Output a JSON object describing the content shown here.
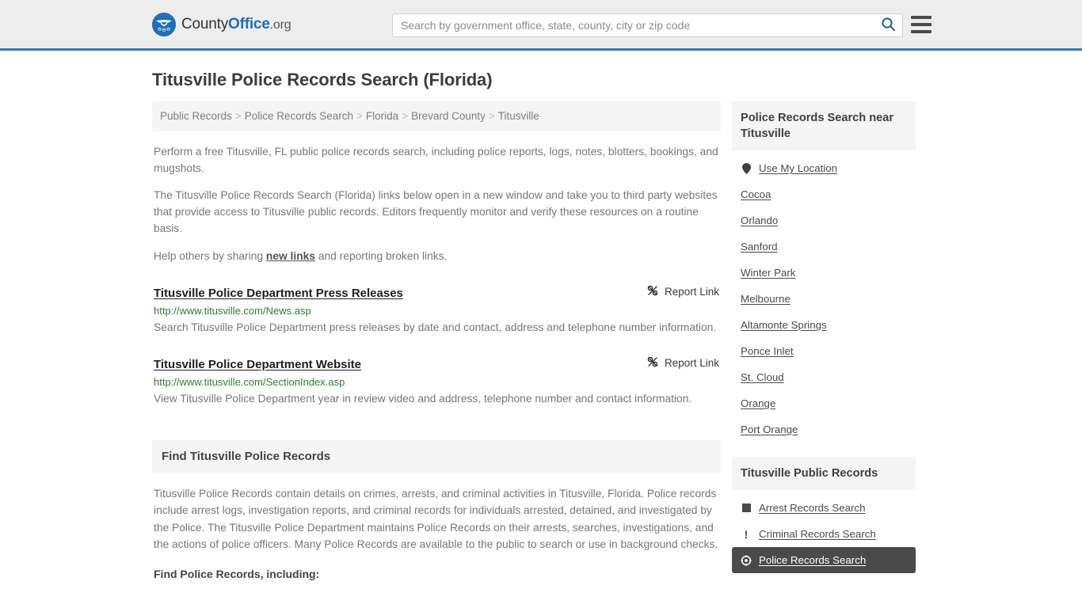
{
  "header": {
    "logo": {
      "icon": "eagle-shield-icon",
      "text_county": "County",
      "text_office": "Office",
      "text_org": ".org"
    },
    "search": {
      "placeholder": "Search by government office, state, county, city or zip code",
      "value": "",
      "search_icon": "search-icon"
    },
    "menu_icon": "hamburger-menu-icon",
    "accent_color": "#3a77ab",
    "background_color": "#ededed"
  },
  "page": {
    "title": "Titusville Police Records Search (Florida)"
  },
  "breadcrumb": {
    "items": [
      {
        "label": "Public Records"
      },
      {
        "label": "Police Records Search"
      },
      {
        "label": "Florida"
      },
      {
        "label": "Brevard County"
      },
      {
        "label": "Titusville"
      }
    ],
    "separator": ">"
  },
  "intro": {
    "paragraph1": "Perform a free Titusville, FL public police records search, including police reports, logs, notes, blotters, bookings, and mugshots.",
    "paragraph2": "The Titusville Police Records Search (Florida) links below open in a new window and take you to third party websites that provide access to Titusville public records. Editors frequently monitor and verify these resources on a routine basis.",
    "paragraph3_before": "Help others by sharing ",
    "paragraph3_link": "new links",
    "paragraph3_after": " and reporting broken links."
  },
  "results": [
    {
      "title": "Titusville Police Department Press Releases",
      "url": "http://www.titusville.com/News.asp",
      "description": "Search Titusville Police Department press releases by date and contact, address and telephone number information.",
      "report_label": "Report Link",
      "report_icon": "broken-link-icon"
    },
    {
      "title": " Titusville Police Department Website",
      "url": "http://www.titusville.com/SectionIndex.asp",
      "description": "View Titusville Police Department year in review video and address, telephone number and contact information.",
      "report_label": "Report Link",
      "report_icon": "broken-link-icon"
    }
  ],
  "find_section": {
    "heading": "Find Titusville Police Records",
    "body": "Titusville Police Records contain details on crimes, arrests, and criminal activities in Titusville, Florida. Police records include arrest logs, investigation reports, and criminal records for individuals arrested, detained, and investigated by the Police. The Titusville Police Department maintains Police Records on their arrests, searches, investigations, and the actions of police officers. Many Police Records are available to the public to search or use in background checks.",
    "subheading": "Find Police Records, including:"
  },
  "sidebar": {
    "nearby": {
      "heading": "Police Records Search near Titusville",
      "items": [
        {
          "label": "Use My Location",
          "icon": "map-pin-icon"
        },
        {
          "label": "Cocoa",
          "icon": ""
        },
        {
          "label": "Orlando",
          "icon": ""
        },
        {
          "label": "Sanford",
          "icon": ""
        },
        {
          "label": "Winter Park",
          "icon": ""
        },
        {
          "label": "Melbourne",
          "icon": ""
        },
        {
          "label": "Altamonte Springs",
          "icon": ""
        },
        {
          "label": "Ponce Inlet",
          "icon": ""
        },
        {
          "label": "St. Cloud",
          "icon": ""
        },
        {
          "label": "Orange",
          "icon": ""
        },
        {
          "label": "Port Orange",
          "icon": ""
        }
      ]
    },
    "public_records": {
      "heading": "Titusville Public Records",
      "items": [
        {
          "label": "Arrest Records Search",
          "icon": "fingerprint-square-icon",
          "active": false
        },
        {
          "label": "Criminal Records Search",
          "icon": "exclamation-icon",
          "active": false
        },
        {
          "label": "Police Records Search",
          "icon": "police-badge-icon",
          "active": true
        }
      ]
    }
  }
}
